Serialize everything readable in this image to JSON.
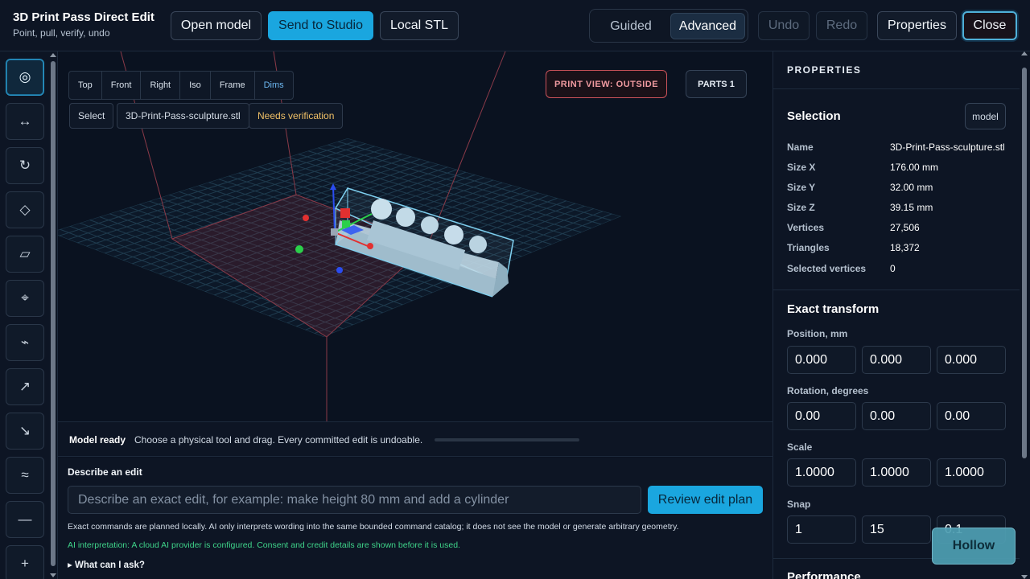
{
  "header": {
    "title": "3D Print Pass Direct Edit",
    "subtitle": "Point, pull, verify, undo",
    "open_model": "Open model",
    "send_to_studio": "Send to Studio",
    "local_stl": "Local STL",
    "mode_guided": "Guided",
    "mode_advanced": "Advanced",
    "undo": "Undo",
    "redo": "Redo",
    "properties": "Properties",
    "close": "Close"
  },
  "tools": [
    {
      "icon": "◎",
      "name": "select"
    },
    {
      "icon": "↔",
      "name": "move"
    },
    {
      "icon": "↻",
      "name": "rotate"
    },
    {
      "icon": "◇",
      "name": "vertex"
    },
    {
      "icon": "▱",
      "name": "face"
    },
    {
      "icon": "⌖",
      "name": "point"
    },
    {
      "icon": "⌁",
      "name": "cut"
    },
    {
      "icon": "↗",
      "name": "pull"
    },
    {
      "icon": "↘",
      "name": "push"
    },
    {
      "icon": "≈",
      "name": "smooth"
    },
    {
      "icon": "—",
      "name": "measure"
    },
    {
      "icon": "+",
      "name": "add"
    }
  ],
  "viewport": {
    "views": [
      "Top",
      "Front",
      "Right",
      "Iso",
      "Frame",
      "Dims"
    ],
    "select_chip": "Select",
    "file_chip": "3D-Print-Pass-sculpture.stl",
    "verify_chip": "Needs verification",
    "print_view": "PRINT VIEW: OUTSIDE",
    "parts": "PARTS 1"
  },
  "status": {
    "label": "Model ready",
    "text": "Choose a physical tool and drag. Every committed edit is undoable.",
    "progress": 0
  },
  "edit": {
    "label": "Describe an edit",
    "placeholder": "Describe an exact edit, for example: make height 80 mm and add a cylinder",
    "review": "Review edit plan",
    "note1": "Exact commands are planned locally. AI only interprets wording into the same bounded command catalog; it does not see the model or generate arbitrary geometry.",
    "note2": "AI interpretation: A cloud AI provider is configured. Consent and credit details are shown before it is used.",
    "disclosure": "▸ What can I ask?"
  },
  "properties": {
    "heading": "PROPERTIES",
    "selection_title": "Selection",
    "model_btn": "model",
    "rows": [
      {
        "k": "Name",
        "v": "3D-Print-Pass-sculpture.stl"
      },
      {
        "k": "Size X",
        "v": "176.00 mm"
      },
      {
        "k": "Size Y",
        "v": "32.00 mm"
      },
      {
        "k": "Size Z",
        "v": "39.15 mm"
      },
      {
        "k": "Vertices",
        "v": "27,506"
      },
      {
        "k": "Triangles",
        "v": "18,372"
      },
      {
        "k": "Selected vertices",
        "v": "0"
      }
    ],
    "transform_title": "Exact transform",
    "position_label": "Position, mm",
    "position": [
      "0.000",
      "0.000",
      "0.000"
    ],
    "rotation_label": "Rotation, degrees",
    "rotation": [
      "0.00",
      "0.00",
      "0.00"
    ],
    "scale_label": "Scale",
    "scale": [
      "1.0000",
      "1.0000",
      "1.0000"
    ],
    "snap_label": "Snap",
    "snap": [
      "1",
      "15",
      "0.1"
    ],
    "performance_title": "Performance"
  },
  "hollow_button": "Hollow",
  "colors": {
    "accent": "#1aa6df",
    "warning": "#f0c066",
    "danger": "#c9525a",
    "ok": "#3fd48a"
  }
}
